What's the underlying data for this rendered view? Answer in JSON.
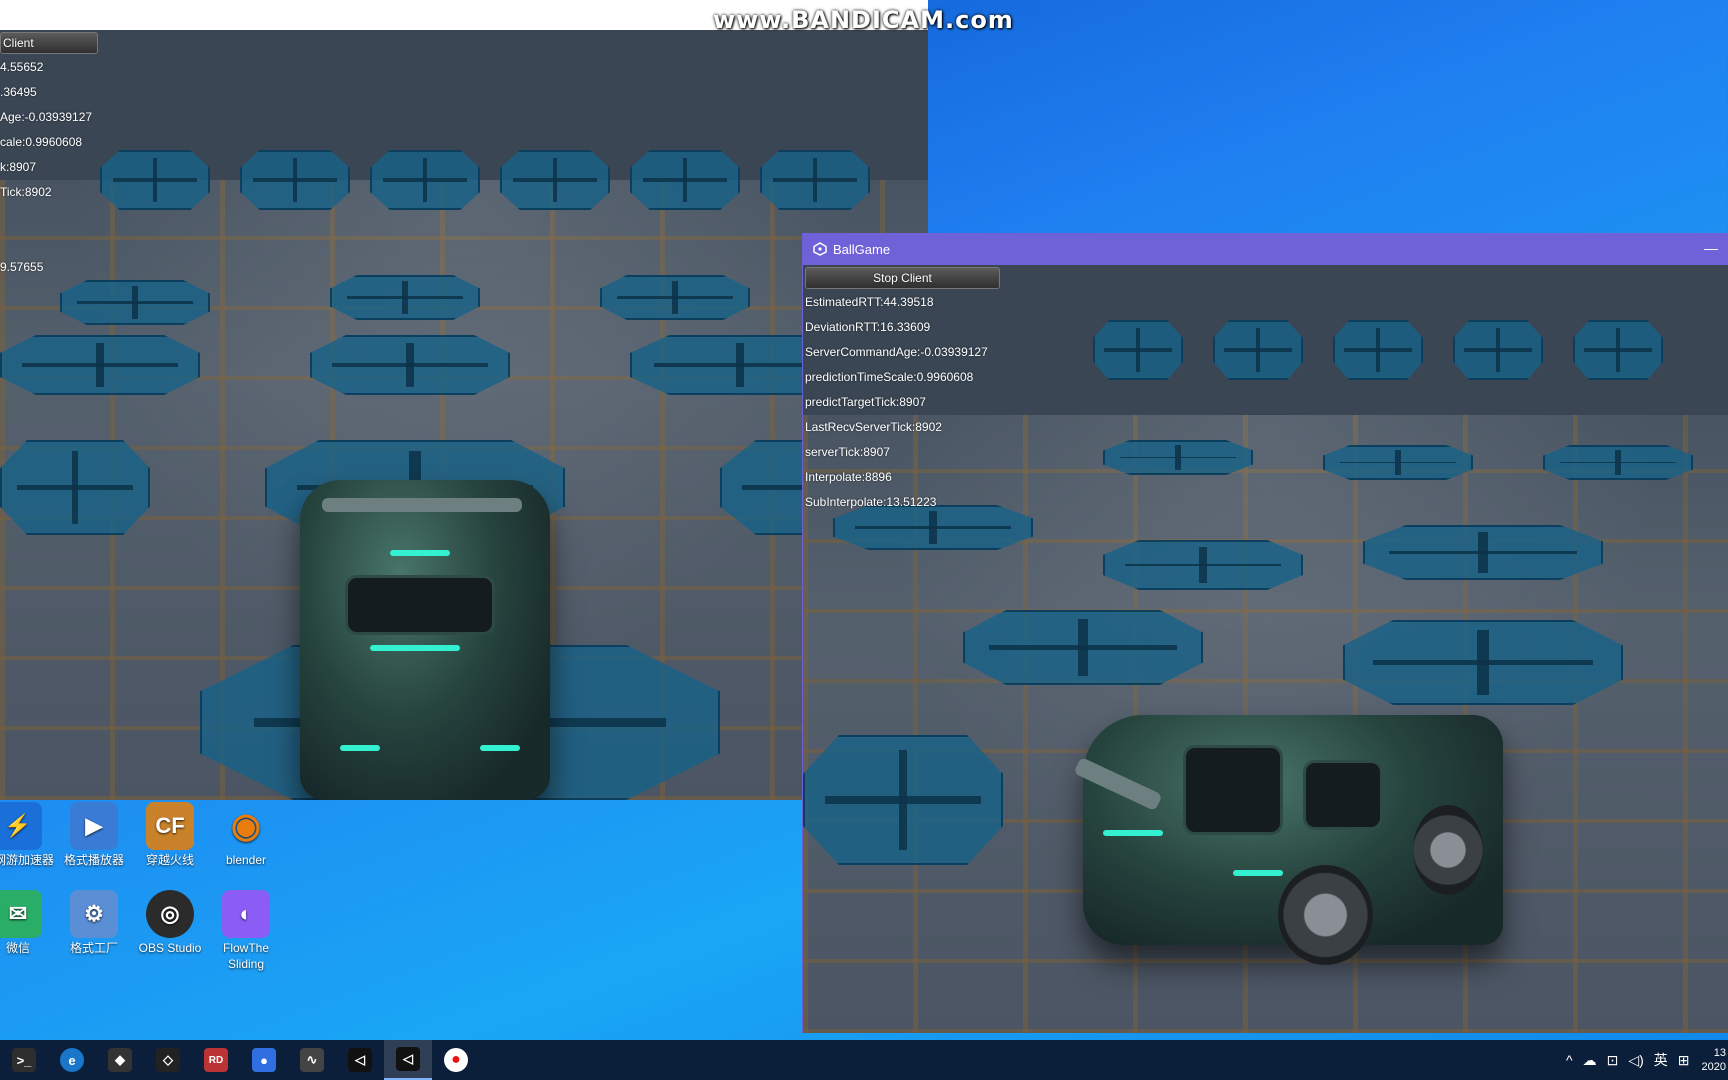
{
  "watermark": "www.BANDICAM.com",
  "left_window": {
    "button_label": "Client",
    "stats": [
      "4.55652",
      ".36495",
      "Age:-0.03939127",
      "cale:0.9960608",
      "k:8907",
      "Tick:8902",
      "",
      "",
      "9.57655"
    ]
  },
  "right_window": {
    "title": "BallGame",
    "minimize_label": "—",
    "button_label": "Stop Client",
    "stats": [
      "EstimatedRTT:44.39518",
      "DeviationRTT:16.33609",
      "ServerCommandAge:-0.03939127",
      "predictionTimeScale:0.9960608",
      "predictTargetTick:8907",
      "LastRecvServerTick:8902",
      "serverTick:8907",
      "Interpolate:8896",
      "SubInterpolate:13.51223"
    ]
  },
  "desktop_icons": [
    {
      "label": "讯网游加速器",
      "icon": "accelerator-icon",
      "color": "#1a6fd8",
      "glyph": "⚡"
    },
    {
      "label": "格式播放器",
      "icon": "player-icon",
      "color": "#3a7bd5",
      "glyph": "▶"
    },
    {
      "label": "穿越火线",
      "icon": "crossfire-icon",
      "color": "#c9822a",
      "glyph": "CF"
    },
    {
      "label": "blender",
      "icon": "blender-icon",
      "color": "#e87d0d",
      "glyph": "◉"
    },
    {
      "label": "微信",
      "icon": "wechat-icon",
      "color": "#2aae67",
      "glyph": "✉"
    },
    {
      "label": "格式工厂",
      "icon": "format-factory-icon",
      "color": "#5a8fd6",
      "glyph": "⚙"
    },
    {
      "label": "OBS Studio",
      "icon": "obs-icon",
      "color": "#2b2b2b",
      "glyph": "◎"
    },
    {
      "label": "FlowThe Sliding",
      "icon": "flow-icon",
      "color": "#8b5cf6",
      "glyph": "◐"
    }
  ],
  "taskbar": {
    "apps": [
      {
        "name": "terminal-icon",
        "color": "#2d2d2d",
        "glyph": ">_"
      },
      {
        "name": "edge-icon",
        "color": "#1976c9",
        "glyph": "e"
      },
      {
        "name": "unreal-launcher-icon",
        "color": "#333",
        "glyph": "◆"
      },
      {
        "name": "unity-hub-icon",
        "color": "#222",
        "glyph": "◇"
      },
      {
        "name": "renderdoc-icon",
        "color": "#b33",
        "glyph": "RD"
      },
      {
        "name": "maps-icon",
        "color": "#2f6fe0",
        "glyph": "●"
      },
      {
        "name": "profiler-icon",
        "color": "#444",
        "glyph": "∿"
      },
      {
        "name": "unity-icon",
        "color": "#111",
        "glyph": "◁"
      },
      {
        "name": "unity-active-icon",
        "color": "#111",
        "glyph": "◁"
      },
      {
        "name": "bandicam-record-icon",
        "color": "#e11",
        "glyph": "●"
      }
    ],
    "tray": {
      "chevron": "^",
      "cloud": "☁",
      "network": "⊡",
      "volume": "◁)",
      "ime": "英",
      "keyboard": "⊞",
      "time": "13",
      "date": "2020"
    }
  }
}
